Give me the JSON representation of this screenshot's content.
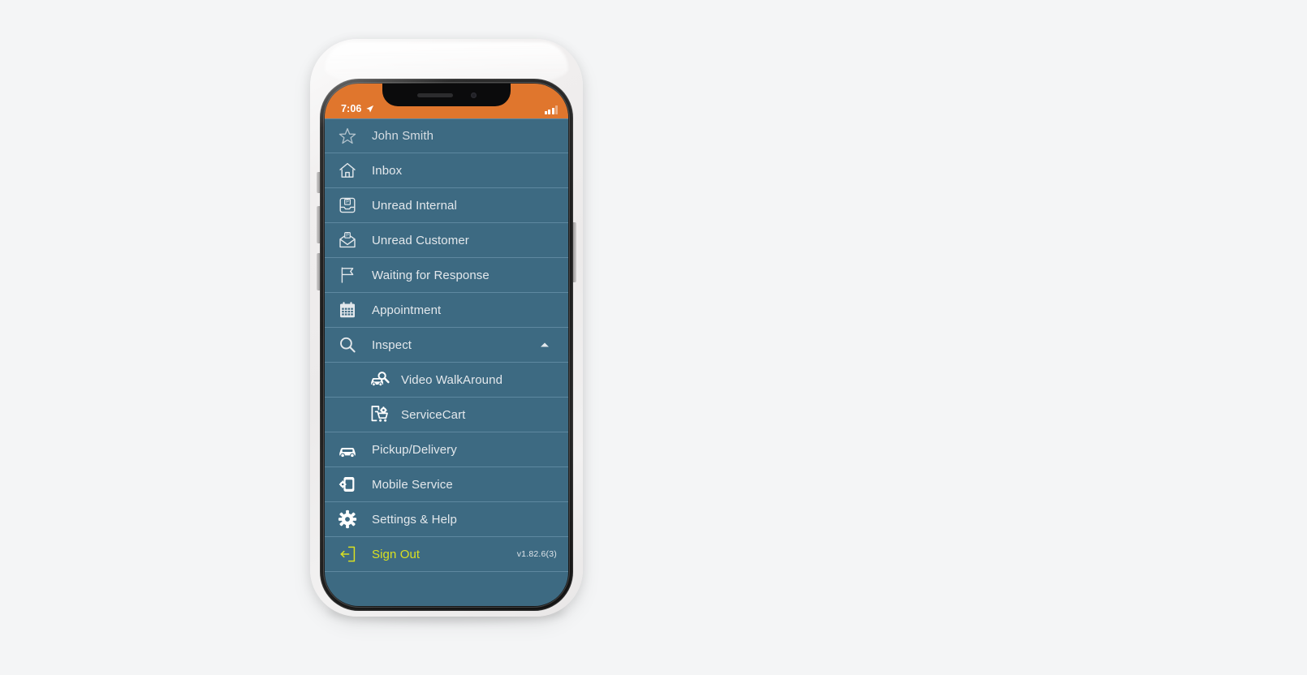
{
  "page": {
    "background_color": "#f4f5f6"
  },
  "device": {
    "type": "smartphone-mockup",
    "frame_color": "#1b1b1b",
    "case_color": "#f1efef"
  },
  "status_bar": {
    "time": "7:06",
    "location_icon": "location-arrow-icon",
    "signal_icon": "cellular-signal-icon",
    "background_color": "#e0762d",
    "text_color": "#ffffff"
  },
  "theme": {
    "sidebar_background": "#3d6a82",
    "separator_color": "#5e88a0",
    "label_color": "#e3e8ec",
    "accent_orange": "#e0762d",
    "signout_color": "#d9e021"
  },
  "menu": {
    "items": [
      {
        "label": "John Smith",
        "icon": "star-outline-icon",
        "level": 0,
        "state": "muted"
      },
      {
        "label": "Inbox",
        "icon": "home-icon",
        "level": 0,
        "state": "normal"
      },
      {
        "label": "Unread Internal",
        "icon": "inbox-tray-icon",
        "level": 0,
        "state": "normal"
      },
      {
        "label": "Unread Customer",
        "icon": "envelope-open-icon",
        "level": 0,
        "state": "normal"
      },
      {
        "label": "Waiting for Response",
        "icon": "flag-icon",
        "level": 0,
        "state": "normal"
      },
      {
        "label": "Appointment",
        "icon": "calendar-icon",
        "level": 0,
        "state": "normal"
      },
      {
        "label": "Inspect",
        "icon": "search-icon",
        "level": 0,
        "state": "expanded",
        "chevron": "chevron-up-icon"
      },
      {
        "label": "Video WalkAround",
        "icon": "car-magnifier-icon",
        "level": 1,
        "state": "normal"
      },
      {
        "label": "ServiceCart",
        "icon": "service-cart-icon",
        "level": 1,
        "state": "normal"
      },
      {
        "label": "Pickup/Delivery",
        "icon": "car-icon",
        "level": 0,
        "state": "normal"
      },
      {
        "label": "Mobile Service",
        "icon": "mobile-gear-icon",
        "level": 0,
        "state": "normal"
      },
      {
        "label": "Settings & Help",
        "icon": "gear-icon",
        "level": 0,
        "state": "normal"
      },
      {
        "label": "Sign Out",
        "icon": "sign-out-icon",
        "level": 0,
        "state": "signout"
      }
    ]
  },
  "footer": {
    "version": "v1.82.6(3)"
  }
}
